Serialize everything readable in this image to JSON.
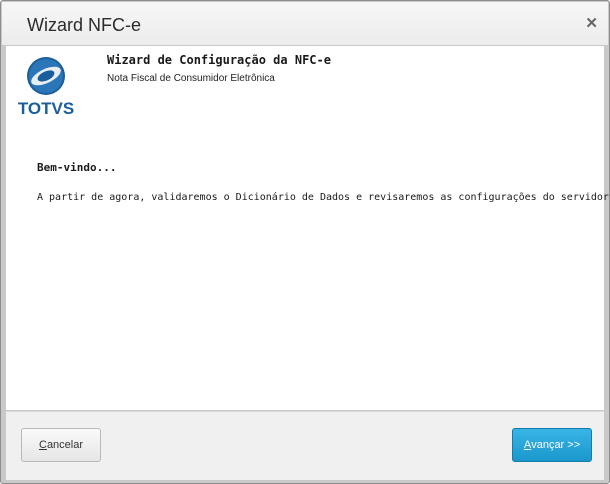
{
  "window": {
    "title": "Wizard NFC-e"
  },
  "header": {
    "title": "Wizard de Configuração da NFC-e",
    "subtitle": "Nota Fiscal de Consumidor Eletrônica",
    "logo_text": "TOTVS"
  },
  "content": {
    "heading": "Bem-vindo...",
    "message": "A partir de agora, validaremos o Dicionário de Dados e revisaremos as configurações do servidor TSS"
  },
  "buttons": {
    "cancel_first": "C",
    "cancel_rest": "ancelar",
    "next_first": "A",
    "next_rest": "vançar >>"
  },
  "colors": {
    "primary_button": "#1a97cc",
    "logo_blue": "#1b5e9c"
  },
  "icons": {
    "close": "close-icon",
    "logo": "totvs-logo"
  }
}
